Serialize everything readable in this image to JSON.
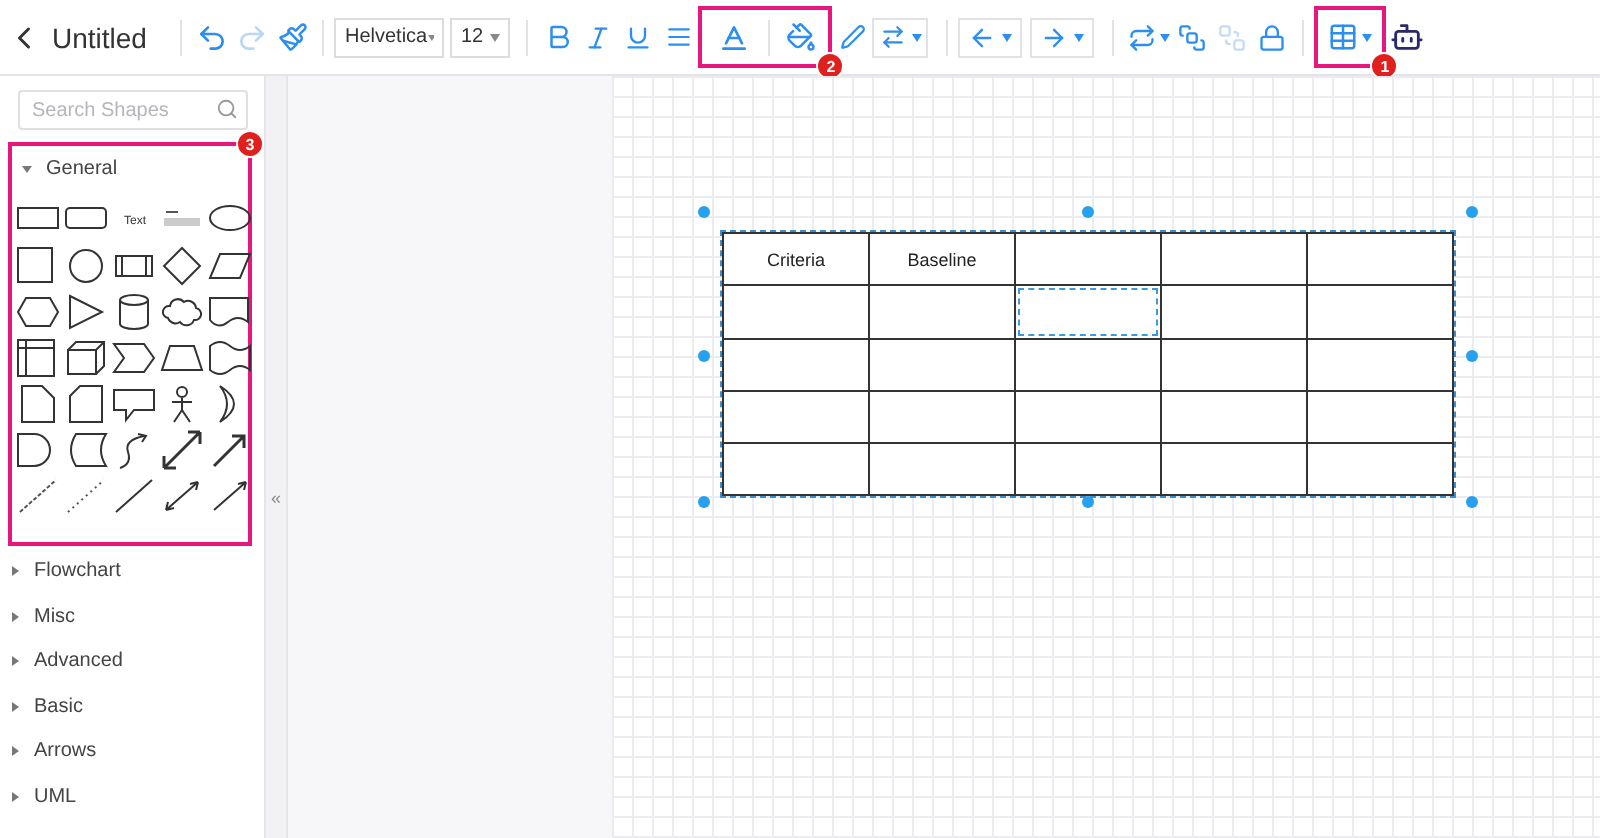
{
  "toolbar": {
    "title": "Untitled",
    "font": "Helvetica",
    "font_size": "12"
  },
  "sidebar": {
    "search": {
      "placeholder": "Search Shapes"
    },
    "sections": [
      {
        "label": "General",
        "expanded": true,
        "text_tile_label": "Text"
      },
      {
        "label": "Flowchart",
        "expanded": false
      },
      {
        "label": "Misc",
        "expanded": false
      },
      {
        "label": "Advanced",
        "expanded": false
      },
      {
        "label": "Basic",
        "expanded": false
      },
      {
        "label": "Arrows",
        "expanded": false
      },
      {
        "label": "UML",
        "expanded": false
      }
    ],
    "collapse": "«"
  },
  "table": {
    "rows": [
      [
        {
          "text": "Criteria",
          "selected": false
        },
        {
          "text": "Baseline",
          "selected": false
        },
        {
          "text": "",
          "selected": false
        },
        {
          "text": "",
          "selected": false
        },
        {
          "text": "",
          "selected": false
        }
      ],
      [
        {
          "text": "",
          "selected": false
        },
        {
          "text": "",
          "selected": false
        },
        {
          "text": "",
          "selected": true
        },
        {
          "text": "",
          "selected": false
        },
        {
          "text": "",
          "selected": false
        }
      ],
      [
        {
          "text": "",
          "selected": false
        },
        {
          "text": "",
          "selected": false
        },
        {
          "text": "",
          "selected": false
        },
        {
          "text": "",
          "selected": false
        },
        {
          "text": "",
          "selected": false
        }
      ],
      [
        {
          "text": "",
          "selected": false
        },
        {
          "text": "",
          "selected": false
        },
        {
          "text": "",
          "selected": false
        },
        {
          "text": "",
          "selected": false
        },
        {
          "text": "",
          "selected": false
        }
      ],
      [
        {
          "text": "",
          "selected": false
        },
        {
          "text": "",
          "selected": false
        },
        {
          "text": "",
          "selected": false
        },
        {
          "text": "",
          "selected": false
        },
        {
          "text": "",
          "selected": false
        }
      ]
    ]
  },
  "callouts": [
    {
      "number": "1"
    },
    {
      "number": "2"
    },
    {
      "number": "3"
    }
  ]
}
